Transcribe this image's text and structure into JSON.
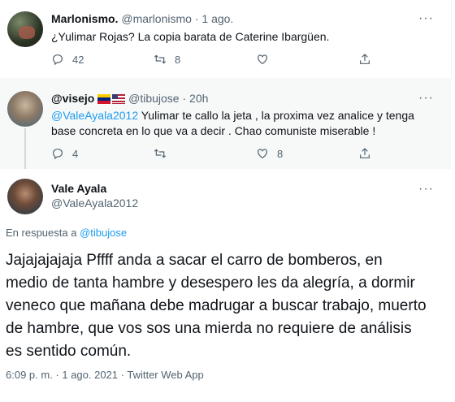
{
  "tweets": [
    {
      "name": "Marlonismo.",
      "handle": "@marlonismo",
      "sep": "·",
      "time": "1 ago.",
      "text": "¿Yulimar Rojas? La copia barata de Caterine Ibargüen.",
      "replies": "42",
      "retweets": "8",
      "likes": ""
    },
    {
      "name": "@visejo",
      "handle": "@tibujose",
      "sep": "·",
      "time": "20h",
      "mention": "@ValeAyala2012",
      "text": " Yulimar te callo la jeta , la proxima vez analice y tenga base concreta en lo que va a decir . Chao comuniste miserable !",
      "replies": "4",
      "retweets": "",
      "likes": "8"
    },
    {
      "name": "Vale Ayala",
      "handle": "@ValeAyala2012",
      "reply_prefix": "En respuesta a",
      "reply_to": "@tibujose",
      "text": "Jajajajajaja Pffff anda a sacar el carro de bomberos, en medio de tanta hambre y desespero les da alegría, a dormir veneco que mañana debe madrugar a buscar trabajo, muerto de hambre, que vos sos una mierda no requiere de análisis es sentido común.",
      "timestamp": "6:09 p. m. · 1 ago. 2021 · Twitter Web App"
    }
  ],
  "more_glyph": "···",
  "icons": [
    "reply-icon",
    "retweet-icon",
    "like-icon",
    "share-icon",
    "more-icon"
  ],
  "colors": {
    "accent": "#1d9bf0",
    "muted": "#536471",
    "text": "#0f1419",
    "highlight_bg": "#f7f9f9"
  }
}
